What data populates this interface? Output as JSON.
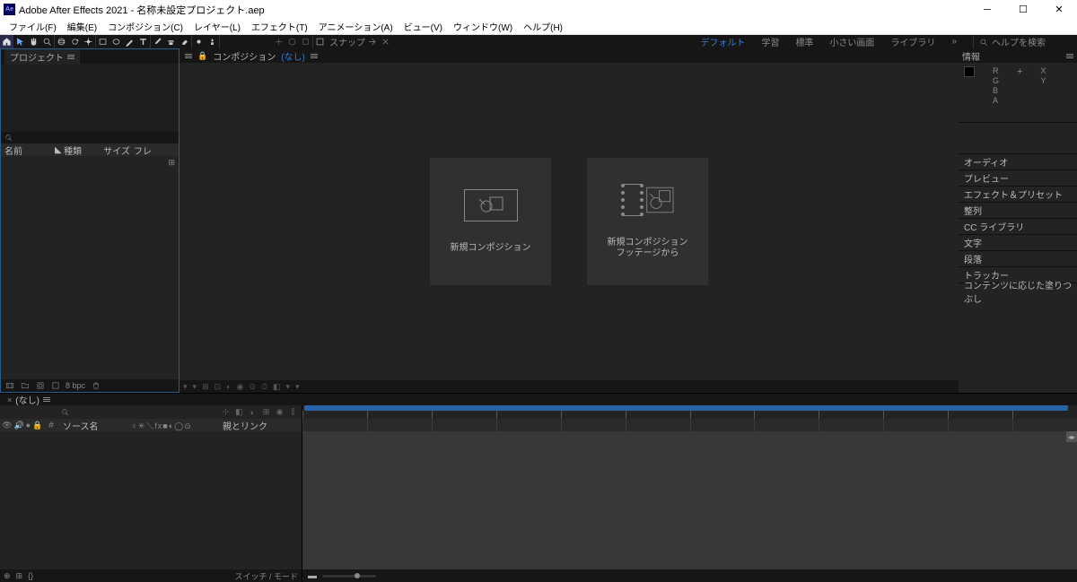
{
  "titlebar": {
    "logo_text": "Ae",
    "title": "Adobe After Effects 2021 - 名称未設定プロジェクト.aep"
  },
  "menubar": {
    "items": [
      "ファイル(F)",
      "編集(E)",
      "コンポジション(C)",
      "レイヤー(L)",
      "エフェクト(T)",
      "アニメーション(A)",
      "ビュー(V)",
      "ウィンドウ(W)",
      "ヘルプ(H)"
    ]
  },
  "toolbar": {
    "snap_label": "スナップ"
  },
  "workspaces": {
    "items": [
      "デフォルト",
      "学習",
      "標準",
      "小さい画面",
      "ライブラリ"
    ],
    "active_index": 0,
    "help_placeholder": "ヘルプを検索"
  },
  "project_panel": {
    "tab": "プロジェクト",
    "columns": {
      "name": "名前",
      "type": "種類",
      "size": "サイズ",
      "frame": "フレ"
    },
    "bpc": "8 bpc"
  },
  "comp_panel": {
    "tab_label": "コンポジション",
    "none": "(なし)",
    "card1": "新規コンポジション",
    "card2_line1": "新規コンポジション",
    "card2_line2": "フッテージから"
  },
  "info_panel": {
    "title": "情報",
    "R": "R",
    "G": "G",
    "B": "B",
    "A": "A",
    "X": "X",
    "Y": "Y"
  },
  "accordions": [
    "オーディオ",
    "プレビュー",
    "エフェクト＆プリセット",
    "整列",
    "CC ライブラリ",
    "文字",
    "段落",
    "トラッカー",
    "コンテンツに応じた塗りつぶし"
  ],
  "timeline": {
    "tab": "(なし)",
    "col_source": "ソース名",
    "col_parent": "親とリンク",
    "col_modes": "♀✳＼fx■◐◯⊙",
    "footer_left": "スイッチ / モード"
  }
}
